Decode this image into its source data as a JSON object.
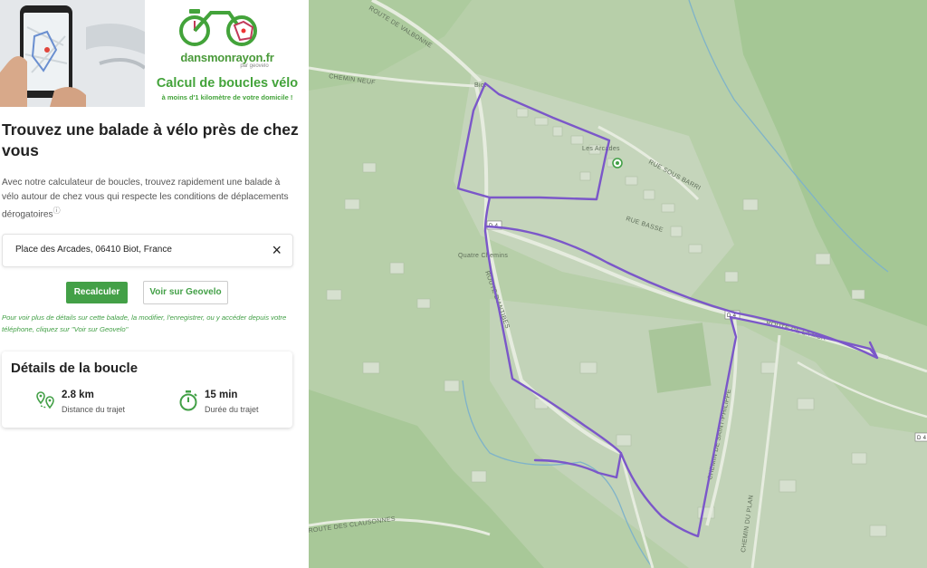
{
  "header": {
    "brand": "dansmonrayon.fr",
    "brand_by": "par geovelo",
    "title": "Calcul de boucles vélo",
    "subtitle": "à moins d'1 kilomètre de votre domicile !"
  },
  "main": {
    "heading": "Trouvez une balade à vélo près de chez vous",
    "intro": "Avec notre calculateur de boucles, trouvez rapidement une balade à vélo autour de chez vous qui respecte les conditions de déplacements dérogatoires",
    "info_icon": "ⓘ"
  },
  "address": {
    "value": "Place des Arcades, 06410 Biot, France",
    "clear_icon": "×"
  },
  "buttons": {
    "recalc": "Recalculer",
    "geovelo": "Voir sur Geovelo"
  },
  "hint": "Pour voir plus de détails sur cette balade, la modifier, l'enregistrer, ou y accéder depuis votre téléphone, cliquez sur \"Voir sur Geovelo\"",
  "details": {
    "title": "Détails de la boucle",
    "distance_value": "2.8 km",
    "distance_label": "Distance du trajet",
    "duration_value": "15 min",
    "duration_label": "Durée du trajet"
  },
  "map": {
    "labels": {
      "route_valbonne": "ROUTE DE VALBONNE",
      "chemin_neuf": "CHEMIN NEUF",
      "biot": "Biot",
      "les_arcades": "Les Arcades",
      "rue_sous_barri": "RUE SOUS BARRI",
      "rue_basse": "RUE BASSE",
      "d4_a": "D 4",
      "d4_b": "D 4",
      "quatre_chemins": "Quatre Chemins",
      "route_antibes": "ROUTE D'ANTIBES",
      "route_de_la_mer": "ROUTE DE LA MER",
      "chemin_saint": "CHEMIN DE SAINT-PHILIPPE",
      "chemin_du_plan": "CHEMIN DU PLAN",
      "route_clausonnes": "ROUTE DES CLAUSONNES",
      "d4_c": "D 4"
    },
    "colors": {
      "route": "#7b57c9",
      "land": "#b7cfa9",
      "urban": "#c8d6bf",
      "forest": "#a5c795",
      "water": "#7fb3c9"
    }
  }
}
